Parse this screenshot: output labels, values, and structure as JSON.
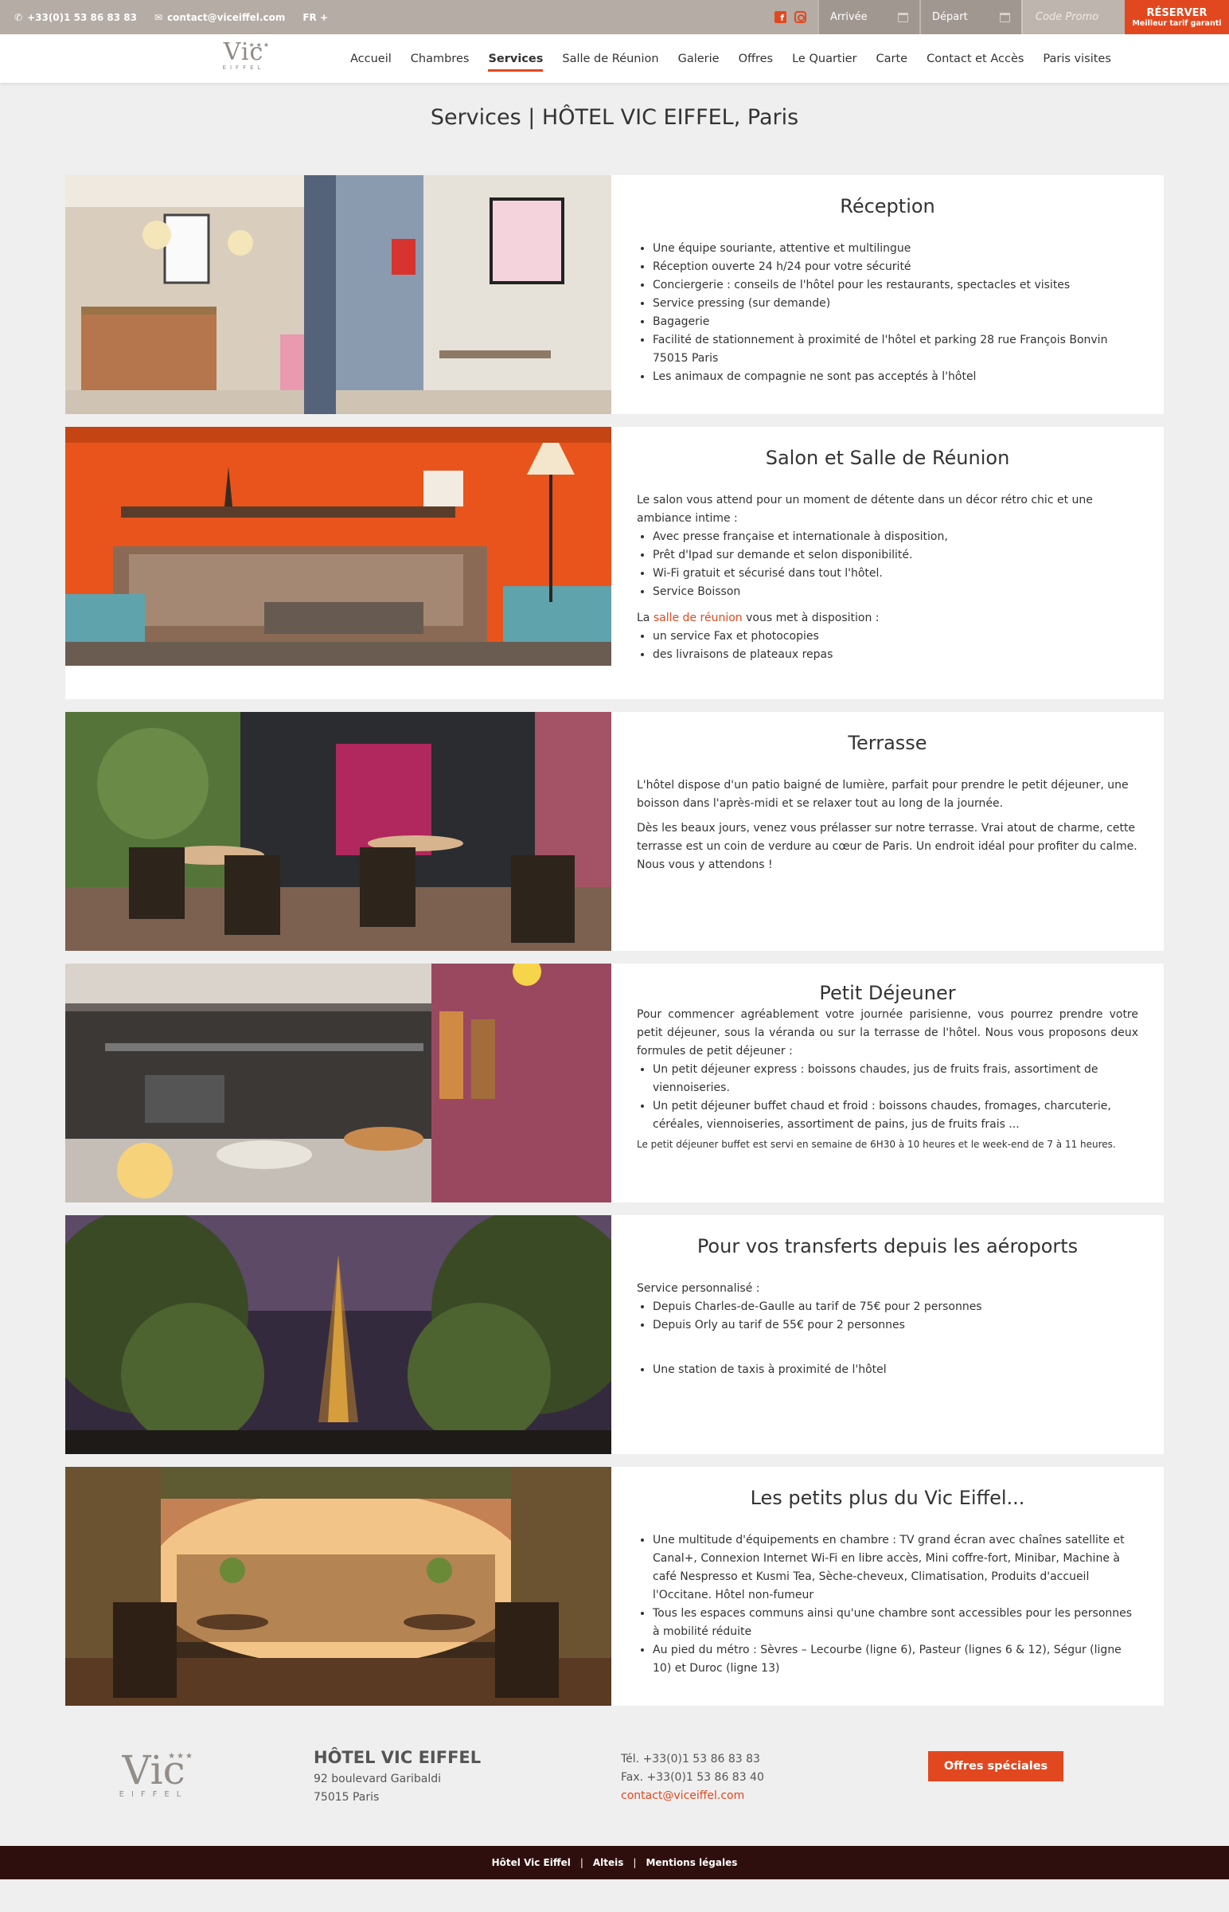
{
  "topbar": {
    "phone": "+33(0)1 53 86 83 83",
    "email": "contact@viceiffel.com",
    "language": "FR +",
    "arrival_label": "Arrivée",
    "departure_label": "Départ",
    "promo_placeholder": "Code Promo",
    "reserve_label": "RÉSERVER",
    "reserve_sublabel": "Meilleur tarif garanti",
    "colors": {
      "accent": "#e2481f",
      "topbar_bg": "#b5aca6"
    }
  },
  "logo": {
    "name": "Vic",
    "sub": "EIFFEL",
    "stars": "★★★"
  },
  "nav": {
    "items": [
      "Accueil",
      "Chambres",
      "Services",
      "Salle de Réunion",
      "Galerie",
      "Offres",
      "Le Quartier",
      "Carte",
      "Contact et Accès",
      "Paris visites"
    ],
    "active": "Services"
  },
  "page_title": "Services | HÔTEL VIC EIFFEL, Paris",
  "sections": {
    "reception": {
      "title": "Réception",
      "bullets": [
        "Une équipe souriante, attentive et multilingue",
        "Réception ouverte 24 h/24 pour votre sécurité",
        "Conciergerie : conseils de l'hôtel pour les restaurants, spectacles et visites",
        "Service pressing (sur demande)",
        "Bagagerie",
        "Facilité de stationnement à proximité de l'hôtel et parking 28  rue François Bonvin 75015 Paris",
        "Les animaux de compagnie ne sont pas acceptés à l'hôtel"
      ]
    },
    "salon": {
      "title": "Salon et Salle de Réunion",
      "intro": "Le salon vous attend pour un moment de détente dans un décor rétro chic et une ambiance intime :",
      "bullets": [
        "Avec presse française et internationale à disposition,",
        "Prêt d'Ipad sur demande et selon disponibilité.",
        "Wi-Fi gratuit et sécurisé dans tout l'hôtel.",
        "Service Boisson"
      ],
      "meeting_prefix": "La",
      "meeting_link": "salle de réunion",
      "meeting_suffix": "vous met à disposition :",
      "meeting_bullets": [
        "un service Fax et photocopies",
        "des livraisons de plateaux repas"
      ]
    },
    "terrasse": {
      "title": "Terrasse",
      "p1": "L'hôtel dispose d'un patio baigné de lumière, parfait pour prendre le petit déjeuner, une boisson dans l'après-midi et se relaxer tout au long de la journée.",
      "p2": "Dès les beaux jours, venez vous prélasser sur notre terrasse. Vrai atout de charme, cette terrasse est un coin de verdure au cœur de Paris. Un endroit idéal pour profiter du calme. Nous vous y attendons !"
    },
    "petit_dejeuner": {
      "title": "Petit Déjeuner",
      "intro": "Pour commencer agréablement votre journée parisienne, vous pourrez prendre votre petit déjeuner, sous la véranda ou sur la terrasse de l'hôtel. Nous vous proposons deux formules de petit déjeuner :",
      "bullets": [
        "Un petit déjeuner express : boissons chaudes, jus de fruits frais, assortiment de viennoiseries.",
        "Un petit déjeuner buffet chaud et froid : boissons chaudes, fromages, charcuterie, céréales, viennoiseries, assortiment de pains, jus de fruits frais ..."
      ],
      "note": "Le petit déjeuner buffet est servi en semaine de 6H30 à 10 heures et le week-end de 7 à 11 heures."
    },
    "transferts": {
      "title": "Pour vos transferts depuis les aéroports",
      "intro": "Service personnalisé :",
      "bullets": [
        "Depuis Charles-de-Gaulle au tarif de 75€ pour 2 personnes",
        "Depuis Orly au tarif de 55€ pour 2 personnes"
      ],
      "bullets2": [
        "Une station de taxis à proximité de l'hôtel"
      ]
    },
    "petits_plus": {
      "title": "Les petits plus du Vic Eiffel...",
      "bullets": [
        "Une multitude d'équipements en chambre : TV grand écran avec chaînes satellite et Canal+, Connexion Internet Wi-Fi en libre accès, Mini coffre-fort, Minibar, Machine à café Nespresso et Kusmi Tea, Sèche-cheveux, Climatisation, Produits d'accueil l'Occitane. Hôtel non-fumeur",
        "Tous les espaces communs ainsi qu'une chambre sont accessibles pour les personnes à mobilité réduite",
        "Au pied du métro : Sèvres – Lecourbe (ligne 6), Pasteur (lignes 6 & 12), Ségur (ligne 10) et Duroc (ligne 13)"
      ]
    }
  },
  "footer": {
    "hotel_name": "HÔTEL VIC EIFFEL",
    "address1": "92 boulevard Garibaldi",
    "address2": "75015 Paris",
    "tel": "Tél. +33(0)1 53 86 83 83",
    "fax": "Fax. +33(0)1 53 86 83 40",
    "email": "contact@viceiffel.com",
    "offers_button": "Offres spéciales"
  },
  "bottombar": {
    "links": [
      "Hôtel Vic Eiffel",
      "Alteis",
      "Mentions légales"
    ],
    "separator": "|"
  }
}
